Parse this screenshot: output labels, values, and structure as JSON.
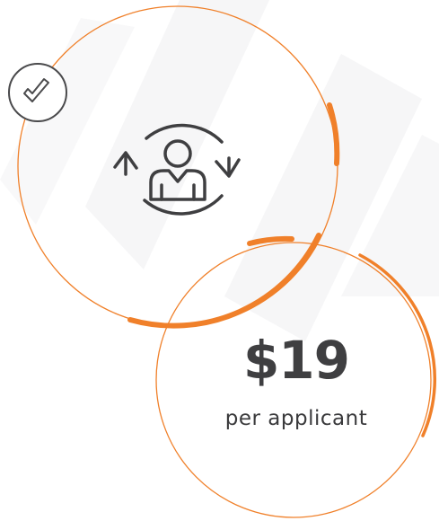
{
  "pricing": {
    "amount": "$19",
    "unit": "per applicant"
  },
  "icons": {
    "badge": "checkmark-icon",
    "main": "user-sync-icon"
  },
  "colors": {
    "accent": "#f0802a",
    "text": "#3f3f41",
    "background_shape": "#f5f5f6"
  }
}
